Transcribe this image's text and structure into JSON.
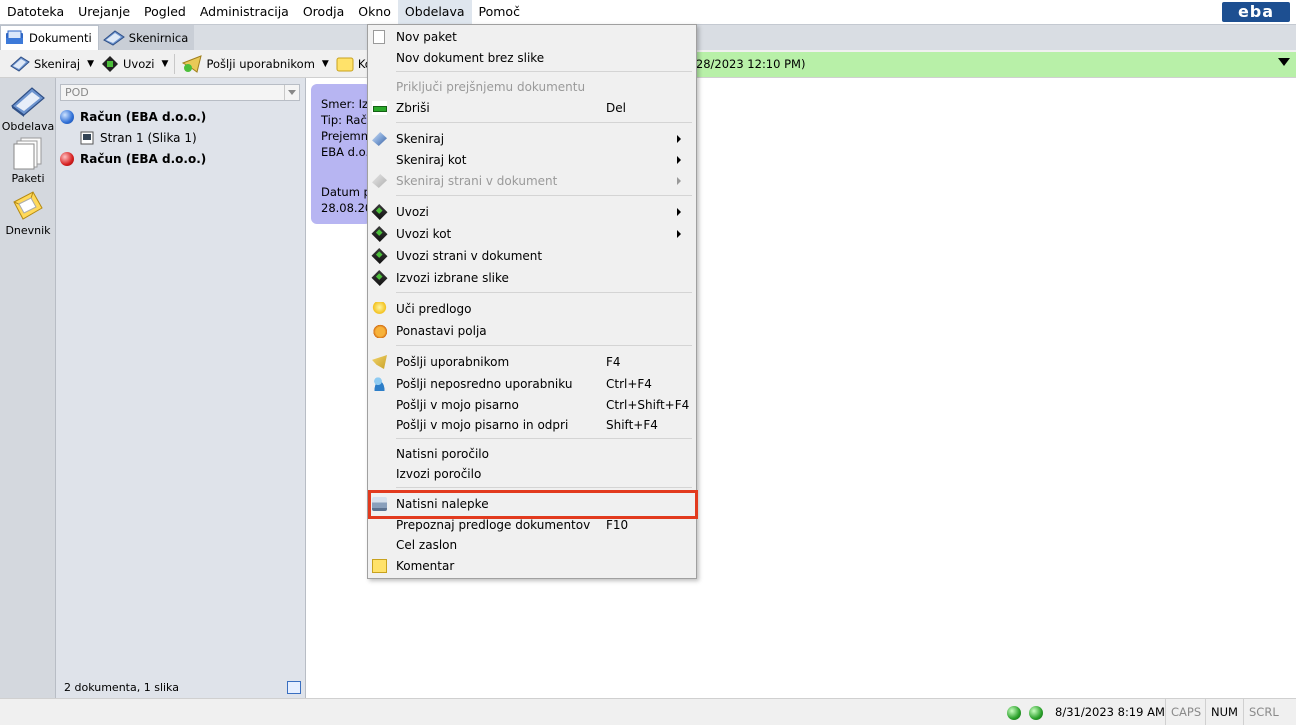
{
  "menubar": {
    "items": [
      "Datoteka",
      "Urejanje",
      "Pogled",
      "Administracija",
      "Orodja",
      "Okno",
      "Obdelava",
      "Pomoč"
    ],
    "logo_text": "eba"
  },
  "tabs": {
    "items": [
      {
        "label": "Dokumenti",
        "icon": "documents-tab-icon"
      },
      {
        "label": "Skenirnica",
        "icon": "scanner-tab-icon"
      }
    ]
  },
  "toolbar": {
    "scan_label": "Skeniraj",
    "import_label": "Uvozi",
    "send_label": "Pošlji uporabnikom",
    "comment_label": "Kom",
    "info_text": "/28/2023 12:10 PM)"
  },
  "leftnav": {
    "items": [
      {
        "label": "Obdelava",
        "icon": "scanner-icon"
      },
      {
        "label": "Paketi",
        "icon": "packages-icon"
      },
      {
        "label": "Dnevnik",
        "icon": "log-icon"
      }
    ]
  },
  "tree": {
    "combo_value": "POD",
    "rows": [
      {
        "label": "Račun (EBA d.o.o.)",
        "status": "blue"
      },
      {
        "label": "Stran 1 (Slika 1)",
        "status": "page"
      },
      {
        "label": "Račun (EBA d.o.o.)",
        "status": "red"
      }
    ],
    "status_text": "2 dokumenta, 1 slika"
  },
  "card": {
    "line1": "Smer: Izh",
    "line2": "Tip: Raču",
    "line3": "Prejemni",
    "line4": "EBA d.o.o",
    "line5": "Datum p",
    "line6": "28.08.20"
  },
  "dropdown": {
    "items": [
      {
        "label": "Nov paket",
        "shortcut": "",
        "icon": "new-package-icon",
        "enabled": true,
        "submenu": false
      },
      {
        "label": "Nov dokument brez slike",
        "shortcut": "",
        "icon": "",
        "enabled": true,
        "submenu": false
      },
      {
        "label": "Priključi prejšnjemu dokumentu",
        "shortcut": "",
        "icon": "",
        "enabled": false,
        "submenu": false
      },
      {
        "label": "Zbriši",
        "shortcut": "Del",
        "icon": "delete-icon",
        "enabled": true,
        "submenu": false
      },
      {
        "label": "Skeniraj",
        "shortcut": "",
        "icon": "scan-icon",
        "enabled": true,
        "submenu": true
      },
      {
        "label": "Skeniraj kot",
        "shortcut": "",
        "icon": "",
        "enabled": true,
        "submenu": true
      },
      {
        "label": "Skeniraj strani v dokument",
        "shortcut": "",
        "icon": "scan-pages-icon",
        "enabled": false,
        "submenu": true
      },
      {
        "label": "Uvozi",
        "shortcut": "",
        "icon": "import-icon",
        "enabled": true,
        "submenu": true
      },
      {
        "label": "Uvozi kot",
        "shortcut": "",
        "icon": "import-as-icon",
        "enabled": true,
        "submenu": true
      },
      {
        "label": "Uvozi strani v dokument",
        "shortcut": "",
        "icon": "import-pages-icon",
        "enabled": true,
        "submenu": false
      },
      {
        "label": "Izvozi izbrane slike",
        "shortcut": "",
        "icon": "export-images-icon",
        "enabled": true,
        "submenu": false
      },
      {
        "label": "Uči predlogo",
        "shortcut": "",
        "icon": "lightbulb-icon",
        "enabled": true,
        "submenu": false
      },
      {
        "label": "Ponastavi polja",
        "shortcut": "",
        "icon": "reset-icon",
        "enabled": true,
        "submenu": false
      },
      {
        "label": "Pošlji uporabnikom",
        "shortcut": "F4",
        "icon": "send-users-icon",
        "enabled": true,
        "submenu": false
      },
      {
        "label": "Pošlji neposredno uporabniku",
        "shortcut": "Ctrl+F4",
        "icon": "send-user-icon",
        "enabled": true,
        "submenu": false
      },
      {
        "label": "Pošlji v mojo pisarno",
        "shortcut": "Ctrl+Shift+F4",
        "icon": "",
        "enabled": true,
        "submenu": false
      },
      {
        "label": "Pošlji v mojo pisarno in odpri",
        "shortcut": "Shift+F4",
        "icon": "",
        "enabled": true,
        "submenu": false
      },
      {
        "label": "Natisni poročilo",
        "shortcut": "",
        "icon": "",
        "enabled": true,
        "submenu": false
      },
      {
        "label": "Izvozi poročilo",
        "shortcut": "",
        "icon": "",
        "enabled": true,
        "submenu": false
      },
      {
        "label": "Natisni nalepke",
        "shortcut": "",
        "icon": "printer-icon",
        "enabled": true,
        "submenu": false
      },
      {
        "label": "Prepoznaj predloge dokumentov",
        "shortcut": "F10",
        "icon": "",
        "enabled": true,
        "submenu": false
      },
      {
        "label": "Cel zaslon",
        "shortcut": "",
        "icon": "",
        "enabled": true,
        "submenu": false
      },
      {
        "label": "Komentar",
        "shortcut": "",
        "icon": "comment-icon",
        "enabled": true,
        "submenu": false
      }
    ]
  },
  "statusbar": {
    "datetime": "8/31/2023 8:19 AM",
    "caps": "CAPS",
    "num": "NUM",
    "scrl": "SCRL"
  },
  "colors": {
    "highlight_border": "#e23a1e",
    "infobar_bg": "#b8f0a8",
    "card_bg": "#b7b5f2",
    "logo_bg": "#1d4f91"
  }
}
